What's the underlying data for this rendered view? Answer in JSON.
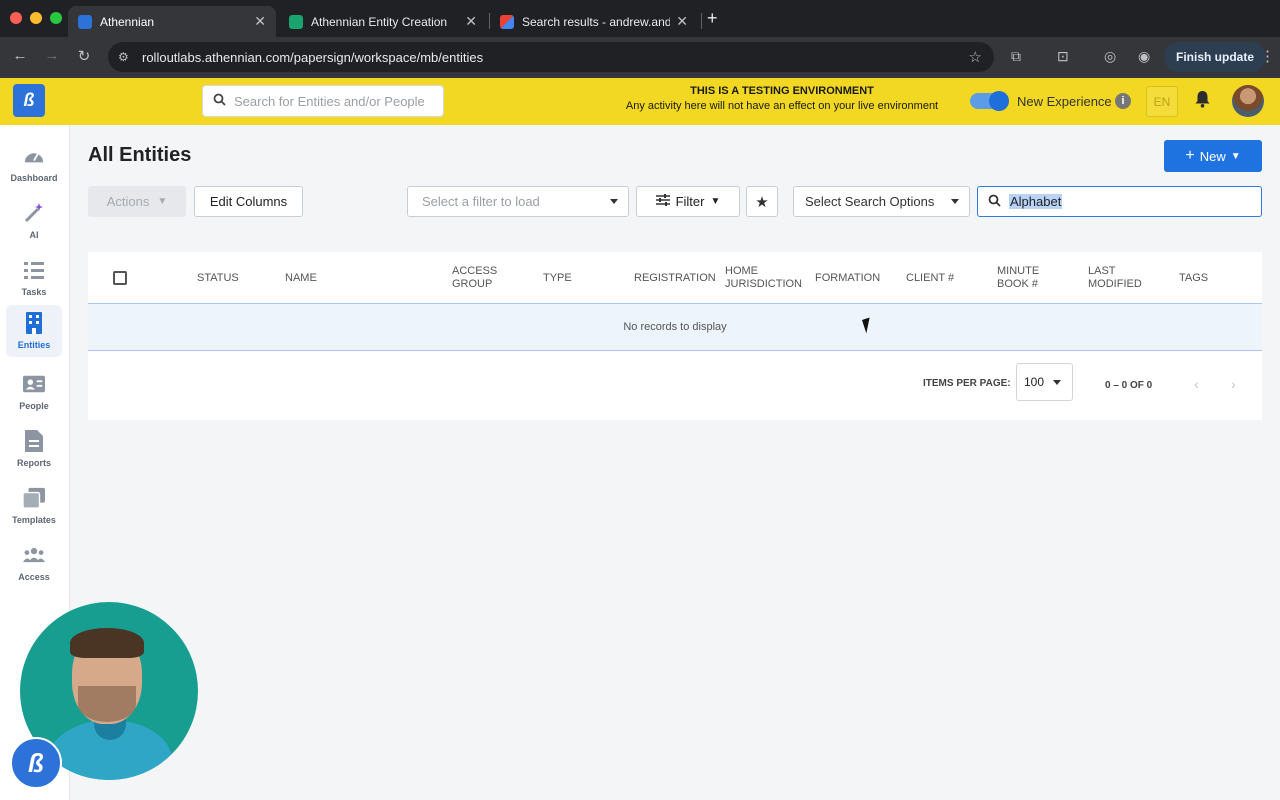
{
  "browser": {
    "tabs": [
      {
        "title": "Athennian",
        "active": true
      },
      {
        "title": "Athennian Entity Creation",
        "active": false
      },
      {
        "title": "Search results - andrew.ande",
        "active": false
      }
    ],
    "url": "rolloutlabs.athennian.com/papersign/workspace/mb/entities",
    "finish_update": "Finish update"
  },
  "topbar": {
    "logo_letter": "ß",
    "search_placeholder": "Search for Entities and/or People",
    "env_title": "THIS IS A TESTING ENVIRONMENT",
    "env_subtitle": "Any activity here will not have an effect on your live environment",
    "new_experience": "New Experience",
    "lang": "EN"
  },
  "sidebar": {
    "items": [
      {
        "label": "Dashboard",
        "icon": "gauge-icon"
      },
      {
        "label": "AI",
        "icon": "magic-wand-icon"
      },
      {
        "label": "Tasks",
        "icon": "checklist-icon"
      },
      {
        "label": "Entities",
        "icon": "building-icon",
        "active": true
      },
      {
        "label": "People",
        "icon": "id-card-icon"
      },
      {
        "label": "Reports",
        "icon": "document-icon"
      },
      {
        "label": "Templates",
        "icon": "copy-icon"
      },
      {
        "label": "Access",
        "icon": "users-icon"
      }
    ]
  },
  "main": {
    "title": "All Entities",
    "new_label": "New",
    "actions_label": "Actions",
    "edit_columns_label": "Edit Columns",
    "filter_load_placeholder": "Select a filter to load",
    "filter_label": "Filter",
    "search_options_label": "Select Search Options",
    "search_value": "Alphabet"
  },
  "table": {
    "columns": [
      "STATUS",
      "NAME",
      "ACCESS GROUP",
      "TYPE",
      "REGISTRATION",
      "HOME JURISDICTION",
      "FORMATION",
      "CLIENT #",
      "MINUTE BOOK #",
      "LAST MODIFIED",
      "TAGS"
    ],
    "empty_message": "No records to display",
    "items_per_page_label": "ITEMS PER PAGE:",
    "items_per_page": "100",
    "range": "0 – 0 OF 0"
  },
  "colors": {
    "banner": "#f2d822",
    "primary": "#1f73e1",
    "webcam_bg": "#189e91"
  }
}
